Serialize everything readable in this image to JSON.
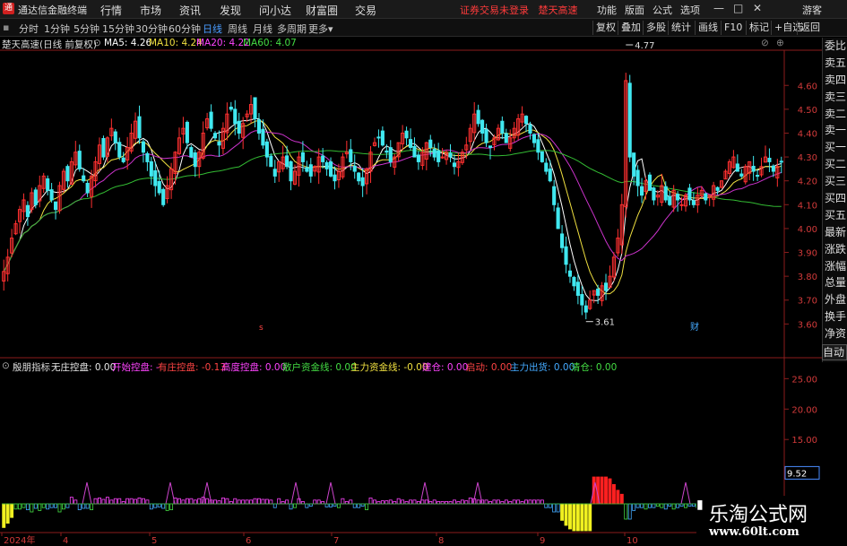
{
  "app": {
    "title": "通达信金融终端",
    "menus": [
      "行情",
      "市场",
      "资讯",
      "发现",
      "问小达",
      "财富圈",
      "交易"
    ],
    "status_warning": "证券交易未登录",
    "status_stock": "楚天高速",
    "right_menus": [
      "功能",
      "版面",
      "公式",
      "选项"
    ],
    "user": "游客"
  },
  "toolbar": {
    "periods": [
      "分时",
      "1分钟",
      "5分钟",
      "15分钟",
      "30分钟",
      "60分钟",
      "日线",
      "周线",
      "月线",
      "多周期",
      "更多"
    ],
    "active_period": "日线",
    "right_buttons": [
      "复权",
      "叠加",
      "多股",
      "统计",
      "画线",
      "F10",
      "标记",
      "+自选",
      "返回"
    ]
  },
  "info": {
    "stock_title": "楚天高速(日线 前复权)",
    "ma": [
      {
        "label": "MA5: 4.26",
        "color": "#ffffff"
      },
      {
        "label": "MA10: 4.24",
        "color": "#f0e040"
      },
      {
        "label": "MA20: 4.22",
        "color": "#ff44ff"
      },
      {
        "label": "MA60: 4.07",
        "color": "#44dd44"
      }
    ]
  },
  "right_panel": [
    "委比",
    "卖五",
    "卖四",
    "卖三",
    "卖二",
    "卖一",
    "买一",
    "买二",
    "买三",
    "买四",
    "买五",
    "最新",
    "涨跌",
    "涨幅",
    "总量",
    "外盘",
    "换手",
    "净资",
    "收益"
  ],
  "auto_select": "自动",
  "indicator": {
    "name": "殷朋指标",
    "items": [
      {
        "label": "无庄控盘: 0.00",
        "color": "#e8e8e8"
      },
      {
        "label": "开始控盘: -",
        "color": "#ff44ff"
      },
      {
        "label": "有庄控盘: -0.13",
        "color": "#ff4444"
      },
      {
        "label": "高度控盘: 0.00",
        "color": "#ff44ff"
      },
      {
        "label": "散户资金线: 0.00",
        "color": "#44dd44"
      },
      {
        "label": "主力资金线: -0.00",
        "color": "#f0e040"
      },
      {
        "label": "建仓: 0.00",
        "color": "#ff44ff"
      },
      {
        "label": "启动: 0.00",
        "color": "#ff4444"
      },
      {
        "label": "主力出货: 0.00",
        "color": "#44aaff"
      },
      {
        "label": "清仓: 0.00",
        "color": "#44dd44"
      }
    ]
  },
  "chart_data": [
    {
      "type": "candlestick",
      "price_ticks": [
        "4.60",
        "4.50",
        "4.40",
        "4.30",
        "4.20",
        "4.10",
        "4.00",
        "3.90",
        "3.80",
        "3.70",
        "3.60"
      ],
      "ylim": [
        3.56,
        4.74
      ],
      "annotations": [
        {
          "label": "4.77",
          "value": 4.77
        },
        {
          "label": "3.61",
          "value": 3.61
        }
      ],
      "markers": [
        "s",
        "财"
      ],
      "x_axis_labels": [
        "2024年",
        "4",
        "5",
        "6",
        "7",
        "8",
        "9",
        "10"
      ],
      "ma_colors": {
        "ma5": "#ffffff",
        "ma10": "#f0e040",
        "ma20": "#cc33cc",
        "ma60": "#33bb33"
      },
      "up_color": "#ff3030",
      "down_color": "#40e8f0",
      "close": [
        3.82,
        3.88,
        3.96,
        4.02,
        4.08,
        4.12,
        4.05,
        4.15,
        4.1,
        4.18,
        4.22,
        4.16,
        4.12,
        4.08,
        4.18,
        4.24,
        4.2,
        4.28,
        4.32,
        4.25,
        4.2,
        4.15,
        4.22,
        4.28,
        4.35,
        4.3,
        4.38,
        4.42,
        4.36,
        4.3,
        4.28,
        4.34,
        4.4,
        4.45,
        4.38,
        4.32,
        4.28,
        4.22,
        4.18,
        4.15,
        4.1,
        4.18,
        4.25,
        4.32,
        4.38,
        4.42,
        4.36,
        4.3,
        4.26,
        4.32,
        4.4,
        4.46,
        4.42,
        4.38,
        4.35,
        4.42,
        4.48,
        4.5,
        4.44,
        4.4,
        4.44,
        4.48,
        4.52,
        4.46,
        4.4,
        4.35,
        4.3,
        4.26,
        4.22,
        4.28,
        4.3,
        4.26,
        4.2,
        4.24,
        4.3,
        4.28,
        4.24,
        4.22,
        4.26,
        4.3,
        4.28,
        4.25,
        4.22,
        4.2,
        4.24,
        4.3,
        4.32,
        4.28,
        4.24,
        4.2,
        4.18,
        4.25,
        4.32,
        4.36,
        4.38,
        4.35,
        4.32,
        4.28,
        4.3,
        4.36,
        4.4,
        4.38,
        4.34,
        4.3,
        4.28,
        4.32,
        4.36,
        4.34,
        4.3,
        4.28,
        4.3,
        4.32,
        4.3,
        4.26,
        4.28,
        4.32,
        4.35,
        4.42,
        4.48,
        4.44,
        4.4,
        4.36,
        4.34,
        4.38,
        4.42,
        4.4,
        4.36,
        4.38,
        4.42,
        4.46,
        4.48,
        4.44,
        4.4,
        4.36,
        4.32,
        4.28,
        4.24,
        4.2,
        4.1,
        4.0,
        3.92,
        3.85,
        3.8,
        3.76,
        3.72,
        3.68,
        3.65,
        3.7,
        3.74,
        3.72,
        3.76,
        3.74,
        3.8,
        3.88,
        3.96,
        4.1,
        4.62,
        4.3,
        4.22,
        4.18,
        4.14,
        4.2,
        4.16,
        4.12,
        4.14,
        4.18,
        4.12,
        4.1,
        4.16,
        4.12,
        4.1,
        4.14,
        4.12,
        4.1,
        4.14,
        4.16,
        4.12,
        4.14,
        4.18,
        4.16,
        4.2,
        4.24,
        4.28,
        4.3,
        4.24,
        4.22,
        4.26,
        4.28,
        4.24,
        4.22,
        4.26,
        4.3,
        4.28,
        4.24,
        4.26,
        4.28
      ]
    },
    {
      "type": "bar",
      "y_ticks": [
        "25.00",
        "20.00",
        "15.00",
        "10.00",
        "5.00"
      ],
      "ylim": [
        0,
        28
      ],
      "current_value": "9.52"
    }
  ]
}
